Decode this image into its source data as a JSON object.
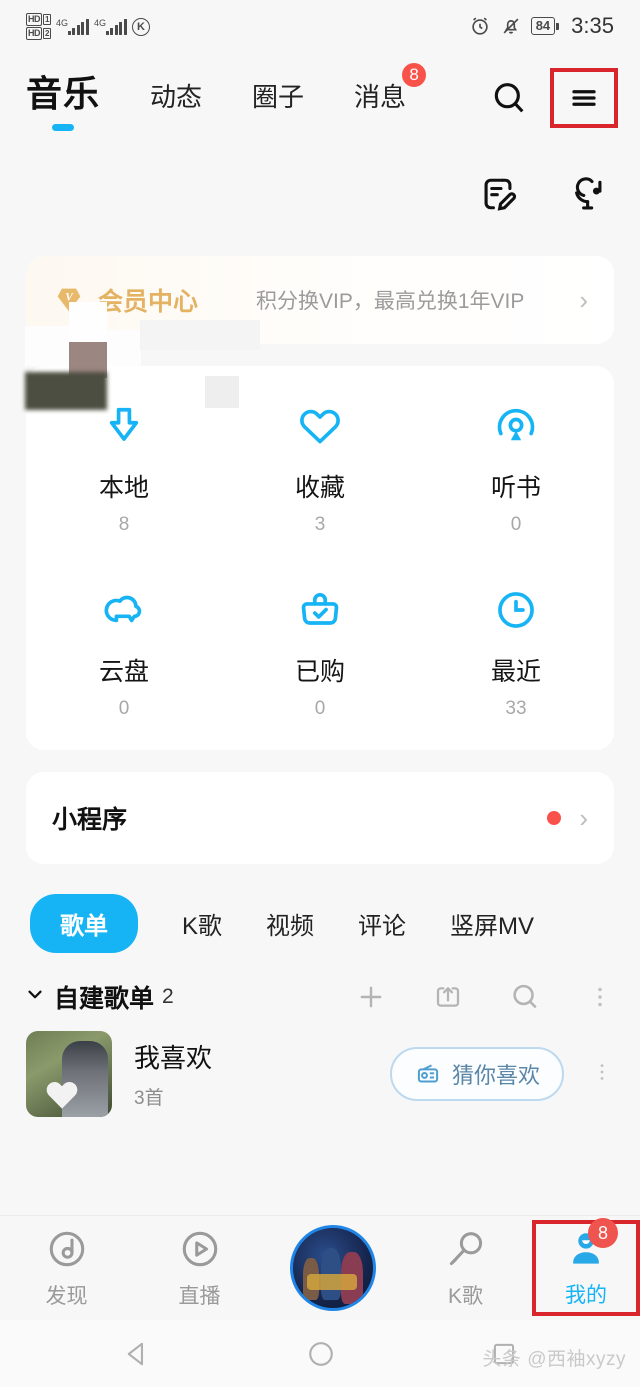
{
  "status_bar": {
    "hd1_label": "HD",
    "hd1_num": "1",
    "hd2_label": "HD",
    "hd2_num": "2",
    "net1": "4G",
    "net2": "4G",
    "k_icon": "K",
    "alarm_icon": "alarm-clock-icon",
    "mute_icon": "bell-muted-icon",
    "battery": "84",
    "time": "3:35"
  },
  "top_nav": {
    "brand": "音乐",
    "items": [
      {
        "label": "动态",
        "badge": ""
      },
      {
        "label": "圈子",
        "badge": ""
      },
      {
        "label": "消息",
        "badge": "8"
      }
    ],
    "search_icon": "search-icon",
    "menu_icon": "hamburger-menu-icon"
  },
  "profile": {
    "edit_icon": "edit-note-icon",
    "karaoke_icon": "microphone-music-icon"
  },
  "vip_card": {
    "diamond_icon": "vip-diamond-icon",
    "title": "会员中心",
    "subtitle": "积分换VIP，最高兑换1年VIP",
    "chevron": "›",
    "accent": "#e3b263"
  },
  "quick_grid": {
    "rows": [
      [
        {
          "icon": "download-arrow-icon",
          "label": "本地",
          "count": "8"
        },
        {
          "icon": "heart-icon",
          "label": "收藏",
          "count": "3"
        },
        {
          "icon": "audiobook-icon",
          "label": "听书",
          "count": "0"
        }
      ],
      [
        {
          "icon": "cloud-icon",
          "label": "云盘",
          "count": "0"
        },
        {
          "icon": "purchased-bag-icon",
          "label": "已购",
          "count": "0"
        },
        {
          "icon": "clock-icon",
          "label": "最近",
          "count": "33"
        }
      ]
    ],
    "accent": "#16b4f5"
  },
  "mini_program": {
    "title": "小程序",
    "dot_color": "#f9524b",
    "chevron": "›"
  },
  "content_tabs": {
    "items": [
      {
        "label": "歌单",
        "active": true
      },
      {
        "label": "K歌",
        "active": false
      },
      {
        "label": "视频",
        "active": false
      },
      {
        "label": "评论",
        "active": false
      },
      {
        "label": "竖屏MV",
        "active": false
      }
    ],
    "active_color": "#16b4f5"
  },
  "playlist_section": {
    "caret_icon": "chevron-down-icon",
    "title": "自建歌单",
    "count": "2",
    "actions": [
      {
        "icon": "plus-icon"
      },
      {
        "icon": "import-icon"
      },
      {
        "icon": "search-icon"
      },
      {
        "icon": "more-vertical-icon"
      }
    ],
    "rows": [
      {
        "name": "我喜欢",
        "songs": "3首",
        "thumb_overlay_icon": "heart-filled-icon",
        "action_label": "猜你喜欢",
        "action_icon": "radio-icon",
        "more_icon": "more-vertical-icon"
      }
    ]
  },
  "bottom_nav": {
    "items": [
      {
        "label": "发现",
        "icon": "discover-note-icon",
        "active": false,
        "badge": ""
      },
      {
        "label": "直播",
        "icon": "live-play-icon",
        "active": false,
        "badge": ""
      },
      {
        "label": "",
        "icon": "album-art-icon",
        "active": false,
        "badge": ""
      },
      {
        "label": "K歌",
        "icon": "karaoke-mic-icon",
        "active": false,
        "badge": ""
      },
      {
        "label": "我的",
        "icon": "profile-person-icon",
        "active": true,
        "badge": "8"
      }
    ],
    "active_color": "#16b4f5",
    "highlight_color": "#d9262c"
  },
  "android_nav": {
    "back_icon": "back-triangle-icon",
    "home_icon": "home-circle-icon",
    "recents_icon": "recents-square-icon"
  },
  "watermark": "头条 @西袖xyzy"
}
